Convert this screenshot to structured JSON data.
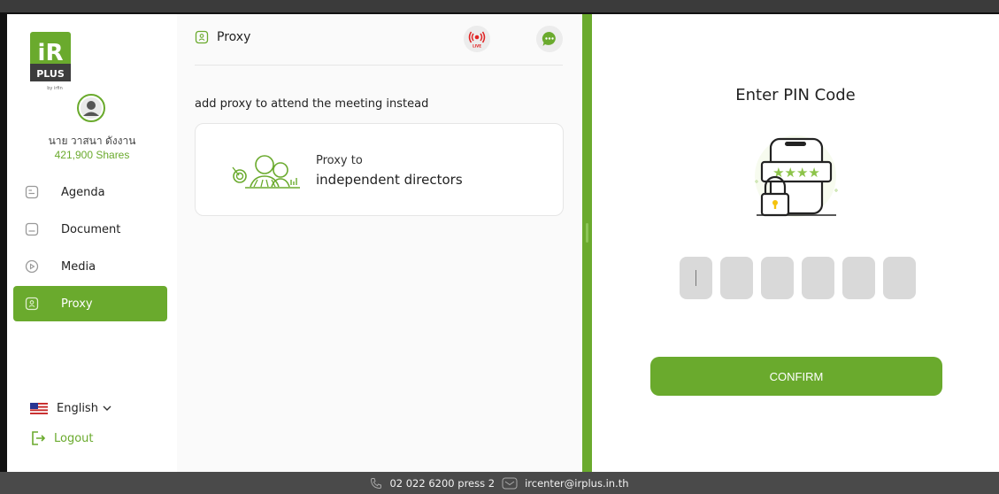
{
  "sidebar": {
    "logo": {
      "top_text": "iR",
      "bottom_text": "PLUS",
      "tagline": "by irfin"
    },
    "user": {
      "name": "นาย วาสนา ดังงาน",
      "shares": "421,900 Shares"
    },
    "items": [
      {
        "label": "Agenda",
        "icon": "agenda-icon"
      },
      {
        "label": "Document",
        "icon": "document-icon"
      },
      {
        "label": "Media",
        "icon": "media-play-icon"
      },
      {
        "label": "Proxy",
        "icon": "proxy-icon",
        "active": true
      }
    ],
    "language": {
      "label": "English",
      "flag": "us-flag-icon"
    },
    "logout_label": "Logout"
  },
  "main": {
    "title": "Proxy",
    "live_badge": "LIVE",
    "description": "add proxy to attend the meeting instead",
    "card": {
      "line1": "Proxy to",
      "line2": "independent directors"
    }
  },
  "pin": {
    "title": "Enter PIN Code",
    "illustration_stars": "★★★★",
    "digits": [
      "",
      "",
      "",
      "",
      "",
      ""
    ],
    "confirm_label": "CONFIRM"
  },
  "footer": {
    "phone": "02 022 6200 press 2",
    "email": "ircenter@irplus.in.th"
  },
  "colors": {
    "accent": "#6aaa2d",
    "live_red": "#e02424",
    "pin_box": "#d9d9d9"
  }
}
